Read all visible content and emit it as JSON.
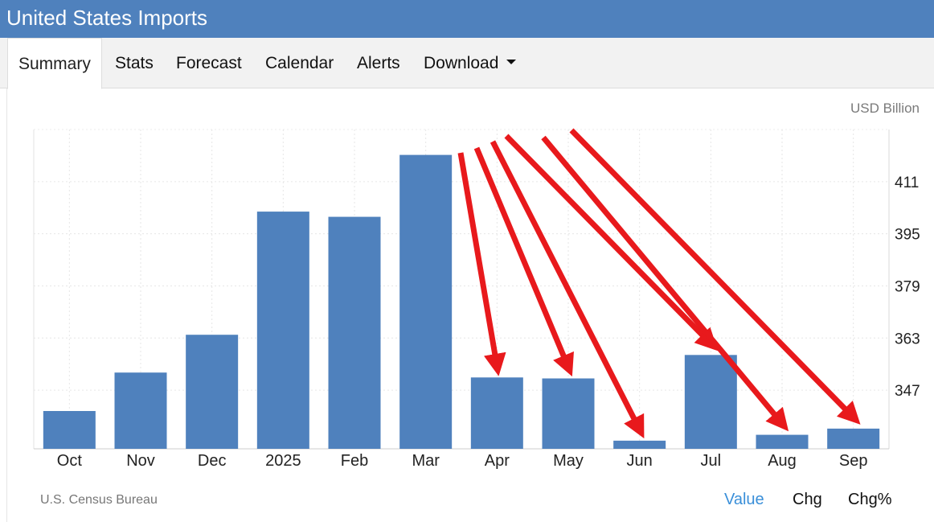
{
  "header": {
    "title": "United States Imports"
  },
  "tabs": [
    {
      "label": "Summary",
      "active": true
    },
    {
      "label": "Stats"
    },
    {
      "label": "Forecast"
    },
    {
      "label": "Calendar"
    },
    {
      "label": "Alerts"
    },
    {
      "label": "Download",
      "has_dropdown": true
    }
  ],
  "chart_data": {
    "type": "bar",
    "categories": [
      "Oct",
      "Nov",
      "Dec",
      "2025",
      "Feb",
      "Mar",
      "Apr",
      "May",
      "Jun",
      "Jul",
      "Aug",
      "Sep"
    ],
    "values": [
      340.6,
      352.4,
      364.0,
      401.8,
      400.2,
      419.2,
      350.9,
      350.6,
      331.5,
      357.8,
      333.3,
      335.2
    ],
    "unit_label": "USD Billion",
    "ylim": [
      329,
      427
    ],
    "yticks": [
      347,
      363,
      379,
      395,
      411
    ],
    "grid": true,
    "bar_color": "#4f81bd",
    "annotation_color": "#e8191c",
    "annotations": [
      {
        "type": "arrow",
        "to": "Apr"
      },
      {
        "type": "arrow",
        "to": "May"
      },
      {
        "type": "arrow",
        "to": "Jun"
      },
      {
        "type": "arrow",
        "to": "Jul"
      },
      {
        "type": "arrow",
        "to": "Aug"
      },
      {
        "type": "arrow",
        "to": "Sep"
      }
    ]
  },
  "footer": {
    "source": "U.S. Census Bureau",
    "modes": [
      {
        "label": "Value",
        "selected": true
      },
      {
        "label": "Chg"
      },
      {
        "label": "Chg%"
      }
    ]
  }
}
